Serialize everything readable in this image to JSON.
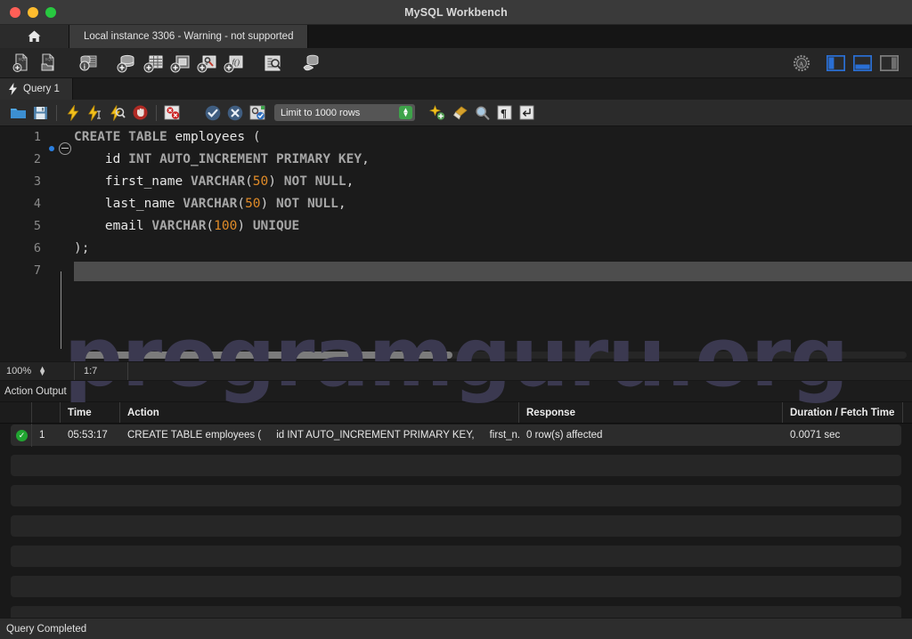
{
  "window": {
    "title": "MySQL Workbench",
    "traffic_lights": [
      "close-button",
      "minimize-button",
      "maximize-button"
    ]
  },
  "connection_tabs": {
    "home_icon": "home-icon",
    "active_tab": "Local instance 3306 - Warning - not supported"
  },
  "main_toolbar": {
    "buttons": [
      {
        "name": "new-sql-tab-icon",
        "title": "New SQL Tab"
      },
      {
        "name": "open-sql-script-icon",
        "title": "Open SQL Script"
      },
      {
        "name": "server-status-icon",
        "title": "Server Status"
      },
      {
        "name": "new-schema-icon",
        "title": "Create New Schema"
      },
      {
        "name": "new-table-icon",
        "title": "Create New Table"
      },
      {
        "name": "new-view-icon",
        "title": "Create New View"
      },
      {
        "name": "new-procedure-icon",
        "title": "Create New Stored Procedure"
      },
      {
        "name": "new-function-icon",
        "title": "Create New Function"
      },
      {
        "name": "search-data-icon",
        "title": "Search Table Data"
      },
      {
        "name": "reconnect-dbms-icon",
        "title": "Reconnect to DBMS"
      }
    ],
    "right_buttons": [
      {
        "name": "admin-gear-icon",
        "title": "Administration"
      },
      {
        "name": "toggle-sidebar-icon",
        "title": "Show/Hide Sidebar",
        "active": true
      },
      {
        "name": "toggle-output-icon",
        "title": "Show/Hide Output",
        "active": true
      },
      {
        "name": "toggle-secondary-sidebar-icon",
        "title": "Show/Hide Secondary Sidebar",
        "active": false
      }
    ]
  },
  "query_tab": {
    "icon": "lightning-icon",
    "label": "Query 1"
  },
  "query_toolbar": {
    "buttons": [
      {
        "name": "open-script-icon",
        "title": "Open a script file"
      },
      {
        "name": "save-script-icon",
        "title": "Save script"
      },
      {
        "name": "execute-statement-icon",
        "title": "Execute"
      },
      {
        "name": "execute-current-statement-icon",
        "title": "Execute Current Statement"
      },
      {
        "name": "explain-statement-icon",
        "title": "Explain Current Statement"
      },
      {
        "name": "stop-execution-icon",
        "title": "Stop"
      },
      {
        "name": "toggle-stop-on-error-icon",
        "title": "Toggle whether execution stops on errors"
      },
      {
        "name": "commit-icon",
        "title": "Commit"
      },
      {
        "name": "rollback-icon",
        "title": "Rollback"
      },
      {
        "name": "autocommit-icon",
        "title": "Toggle Auto-Commit"
      }
    ],
    "limit_label": "Limit to 1000 rows",
    "right_buttons": [
      {
        "name": "beautify-sql-icon",
        "title": "Beautify/Reformat SQL"
      },
      {
        "name": "clear-sql-icon",
        "title": "Clear Context Assistance Cache"
      },
      {
        "name": "find-icon",
        "title": "Find"
      },
      {
        "name": "invisible-chars-icon",
        "title": "Toggle Invisible Characters"
      },
      {
        "name": "wrap-lines-icon",
        "title": "Toggle Word Wrap"
      }
    ]
  },
  "editor": {
    "lines": [
      {
        "n": "1",
        "breakpoint": true,
        "fold": true,
        "tokens": [
          {
            "t": "CREATE",
            "c": "kw"
          },
          {
            "t": " ",
            "c": "pun"
          },
          {
            "t": "TABLE",
            "c": "kw"
          },
          {
            "t": " ",
            "c": "pun"
          },
          {
            "t": "employees",
            "c": "id"
          },
          {
            "t": " (",
            "c": "pun"
          }
        ]
      },
      {
        "n": "2",
        "breakpoint": false,
        "fold": false,
        "tokens": [
          {
            "t": "    id",
            "c": "id"
          },
          {
            "t": " ",
            "c": "pun"
          },
          {
            "t": "INT",
            "c": "kw"
          },
          {
            "t": " ",
            "c": "pun"
          },
          {
            "t": "AUTO_INCREMENT",
            "c": "kw"
          },
          {
            "t": " ",
            "c": "pun"
          },
          {
            "t": "PRIMARY",
            "c": "kw"
          },
          {
            "t": " ",
            "c": "pun"
          },
          {
            "t": "KEY",
            "c": "kw"
          },
          {
            "t": ",",
            "c": "pun"
          }
        ]
      },
      {
        "n": "3",
        "breakpoint": false,
        "fold": false,
        "tokens": [
          {
            "t": "    first_name",
            "c": "id"
          },
          {
            "t": " ",
            "c": "pun"
          },
          {
            "t": "VARCHAR",
            "c": "kw"
          },
          {
            "t": "(",
            "c": "pun"
          },
          {
            "t": "50",
            "c": "num"
          },
          {
            "t": ") ",
            "c": "pun"
          },
          {
            "t": "NOT",
            "c": "kw"
          },
          {
            "t": " ",
            "c": "pun"
          },
          {
            "t": "NULL",
            "c": "kw"
          },
          {
            "t": ",",
            "c": "pun"
          }
        ]
      },
      {
        "n": "4",
        "breakpoint": false,
        "fold": false,
        "tokens": [
          {
            "t": "    last_name",
            "c": "id"
          },
          {
            "t": " ",
            "c": "pun"
          },
          {
            "t": "VARCHAR",
            "c": "kw"
          },
          {
            "t": "(",
            "c": "pun"
          },
          {
            "t": "50",
            "c": "num"
          },
          {
            "t": ") ",
            "c": "pun"
          },
          {
            "t": "NOT",
            "c": "kw"
          },
          {
            "t": " ",
            "c": "pun"
          },
          {
            "t": "NULL",
            "c": "kw"
          },
          {
            "t": ",",
            "c": "pun"
          }
        ]
      },
      {
        "n": "5",
        "breakpoint": false,
        "fold": false,
        "tokens": [
          {
            "t": "    email",
            "c": "id"
          },
          {
            "t": " ",
            "c": "pun"
          },
          {
            "t": "VARCHAR",
            "c": "kw"
          },
          {
            "t": "(",
            "c": "pun"
          },
          {
            "t": "100",
            "c": "num"
          },
          {
            "t": ") ",
            "c": "pun"
          },
          {
            "t": "UNIQUE",
            "c": "kw"
          }
        ]
      },
      {
        "n": "6",
        "breakpoint": false,
        "fold": false,
        "tokens": [
          {
            "t": ");",
            "c": "pun"
          }
        ]
      },
      {
        "n": "7",
        "breakpoint": false,
        "fold": false,
        "current": true,
        "tokens": []
      }
    ]
  },
  "watermark": "programguru.org",
  "editor_status": {
    "zoom": "100%",
    "cursor_position": "1:7"
  },
  "action_output": {
    "panel_label": "Action Output",
    "columns": [
      "",
      "",
      "Time",
      "Action",
      "Response",
      "Duration / Fetch Time"
    ],
    "rows": [
      {
        "status": "success",
        "num": "1",
        "time": "05:53:17",
        "action_parts": [
          "CREATE TABLE employees (",
          "id INT AUTO_INCREMENT PRIMARY KEY,",
          "first_n..."
        ],
        "response": "0 row(s) affected",
        "duration": "0.0071 sec"
      }
    ],
    "empty_row_count": 6
  },
  "status_bar": {
    "message": "Query Completed"
  },
  "colors": {
    "accent_blue": "#2a6fd4",
    "success_green": "#21a531",
    "number_orange": "#e08b28",
    "watermark": "#3b3950"
  }
}
